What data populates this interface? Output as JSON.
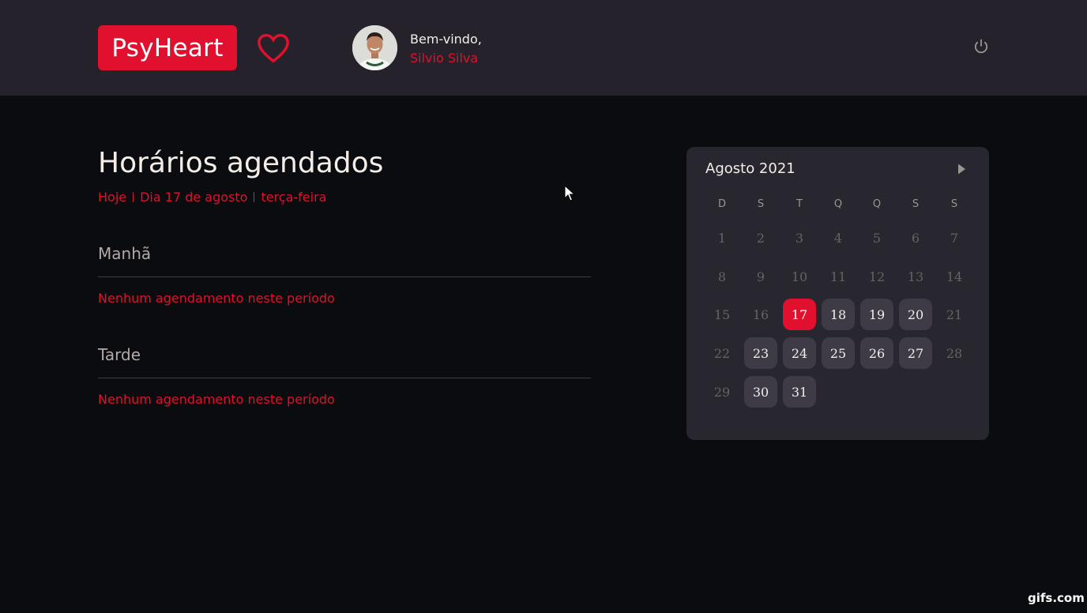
{
  "header": {
    "logo_text": "PsyHeart",
    "greeting": "Bem-vindo,",
    "user_name": "Silvio Silva"
  },
  "main": {
    "title": "Horários agendados",
    "subtitle": {
      "today": "Hoje",
      "date": "Dia 17 de agosto",
      "weekday": "terça-feira"
    },
    "sections": [
      {
        "label": "Manhã",
        "empty_message": "Nenhum agendamento neste período"
      },
      {
        "label": "Tarde",
        "empty_message": "Nenhum agendamento neste período"
      }
    ]
  },
  "calendar": {
    "month_label": "Agosto 2021",
    "weekdays": [
      "D",
      "S",
      "T",
      "Q",
      "Q",
      "S",
      "S"
    ],
    "days": [
      {
        "n": "1",
        "state": "past"
      },
      {
        "n": "2",
        "state": "past"
      },
      {
        "n": "3",
        "state": "past"
      },
      {
        "n": "4",
        "state": "past"
      },
      {
        "n": "5",
        "state": "past"
      },
      {
        "n": "6",
        "state": "past"
      },
      {
        "n": "7",
        "state": "past"
      },
      {
        "n": "8",
        "state": "past"
      },
      {
        "n": "9",
        "state": "past"
      },
      {
        "n": "10",
        "state": "past"
      },
      {
        "n": "11",
        "state": "past"
      },
      {
        "n": "12",
        "state": "past"
      },
      {
        "n": "13",
        "state": "past"
      },
      {
        "n": "14",
        "state": "past"
      },
      {
        "n": "15",
        "state": "past"
      },
      {
        "n": "16",
        "state": "past"
      },
      {
        "n": "17",
        "state": "selected"
      },
      {
        "n": "18",
        "state": "avail"
      },
      {
        "n": "19",
        "state": "avail"
      },
      {
        "n": "20",
        "state": "avail"
      },
      {
        "n": "21",
        "state": "past"
      },
      {
        "n": "22",
        "state": "past"
      },
      {
        "n": "23",
        "state": "avail"
      },
      {
        "n": "24",
        "state": "avail"
      },
      {
        "n": "25",
        "state": "avail"
      },
      {
        "n": "26",
        "state": "avail"
      },
      {
        "n": "27",
        "state": "avail"
      },
      {
        "n": "28",
        "state": "past"
      },
      {
        "n": "29",
        "state": "past"
      },
      {
        "n": "30",
        "state": "avail"
      },
      {
        "n": "31",
        "state": "avail"
      }
    ]
  },
  "colors": {
    "accent": "#e0102e",
    "header_bg": "#25222b",
    "page_bg": "#0b0c0f",
    "card_bg": "#28262e",
    "day_bg": "#3e3b47"
  },
  "icons": {
    "favorite": "heart-icon",
    "logout": "power-icon",
    "next_month": "arrow-right-icon",
    "cursor": "mouse-pointer-icon"
  },
  "watermark": "gifs.com"
}
